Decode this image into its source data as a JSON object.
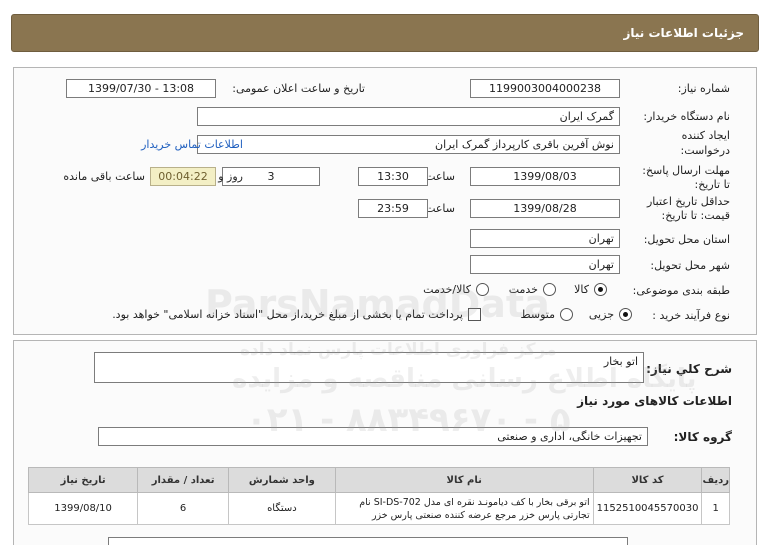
{
  "header": {
    "title": "جزئیات اطلاعات نیاز"
  },
  "form": {
    "need_number": {
      "label": "شماره نیاز:",
      "value": "1199003004000238"
    },
    "announce_datetime": {
      "label": "تاریخ و ساعت اعلان عمومی:",
      "value": "1399/07/30 - 13:08"
    },
    "buyer_org": {
      "label": "نام دستگاه خریدار:",
      "value": "گمرک ایران"
    },
    "creator": {
      "label_line1": "ایجاد کننده",
      "label_line2": "درخواست:",
      "value": "نوش آفرین باقری کارپرداز گمرک ایران",
      "contact_link": "اطلاعات تماس خریدار"
    },
    "reply_deadline": {
      "label_line1": "مهلت ارسال پاسخ:",
      "label_line2": "تا تاریخ:",
      "date": "1399/08/03",
      "time_label": "ساعت",
      "time": "13:30",
      "days": "3",
      "days_label": "روز و",
      "remaining": "00:04:22",
      "remaining_label": "ساعت باقی مانده"
    },
    "price_validity": {
      "label_line1": "حداقل تاریخ اعتبار",
      "label_line2": "قیمت: تا تاریخ:",
      "date": "1399/08/28",
      "time_label": "ساعت",
      "time": "23:59"
    },
    "province": {
      "label": "استان محل تحویل:",
      "value": "تهران"
    },
    "city": {
      "label": "شهر محل تحویل:",
      "value": "تهران"
    },
    "category": {
      "label": "طبقه بندی موضوعی:",
      "options": [
        "کالا",
        "خدمت",
        "کالا/خدمت"
      ],
      "selected": "کالا"
    },
    "purchase_process": {
      "label": "نوع فرآیند خرید :",
      "options": [
        "جزیی",
        "متوسط"
      ],
      "selected": "جزیی",
      "note": "پرداخت تمام یا بخشی از مبلغ خرید،از محل \"اسناد خزانه اسلامی\" خواهد بود."
    }
  },
  "summary": {
    "description_label": "شرح کلي نياز:",
    "description_value": "اتو بخار",
    "goods_info_title": "اطلاعات کالاهای مورد نیاز",
    "goods_group_label": "گروه کالا:",
    "goods_group_value": "تجهیزات خانگی، اداری و صنعتی"
  },
  "table": {
    "columns": [
      "ردیف",
      "کد کالا",
      "نام کالا",
      "واحد شمارش",
      "تعداد / مقدار",
      "تاریخ نیاز"
    ],
    "rows": [
      {
        "row": "1",
        "code": "1152510045570030",
        "name": "اتو برقی بخار با کف دیامونـد نقره ای مدل SI-DS-702 نام تجارتی پارس خزر مرجع عرضه کننده صنعتی پارس خزر",
        "unit": "دستگاه",
        "qty": "6",
        "date": "1399/08/10"
      }
    ]
  },
  "watermark": {
    "line1": "ParsNamadData",
    "line2": "مرکز فراوری اطلاعات پارس نماد داده",
    "line3": "پایگاه اطلاع رسانی مناقصه و مزایده",
    "line4": "۰۲۱ - ۸۸۳۴۹۶۷۰ - ۵"
  }
}
